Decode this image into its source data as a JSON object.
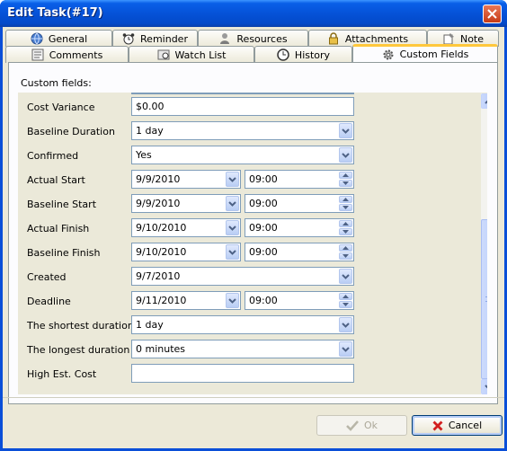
{
  "window": {
    "title": "Edit Task(#17)"
  },
  "tabs_row1": [
    {
      "label": "General",
      "icon": "globe-icon"
    },
    {
      "label": "Reminder",
      "icon": "alarm-clock-icon"
    },
    {
      "label": "Resources",
      "icon": "person-icon"
    },
    {
      "label": "Attachments",
      "icon": "lock-icon"
    },
    {
      "label": "Note",
      "icon": "note-pin-icon"
    }
  ],
  "tabs_row2": [
    {
      "label": "Comments",
      "icon": "comments-icon"
    },
    {
      "label": "Watch List",
      "icon": "watch-list-icon"
    },
    {
      "label": "History",
      "icon": "history-clock-icon"
    },
    {
      "label": "Custom Fields",
      "icon": "gear-icon",
      "active": true
    }
  ],
  "panel": {
    "label": "Custom fields:"
  },
  "fields": [
    {
      "label": "Cost Variance",
      "value": "$0.00",
      "type": "text"
    },
    {
      "label": "Baseline Duration",
      "value": "1 day",
      "type": "combo"
    },
    {
      "label": "Confirmed",
      "value": "Yes",
      "type": "combo"
    },
    {
      "label": "Actual Start",
      "value": "9/9/2010",
      "time": "09:00",
      "type": "datetime"
    },
    {
      "label": "Baseline Start",
      "value": "9/9/2010",
      "time": "09:00",
      "type": "datetime"
    },
    {
      "label": "Actual Finish",
      "value": "9/10/2010",
      "time": "09:00",
      "type": "datetime"
    },
    {
      "label": "Baseline Finish",
      "value": "9/10/2010",
      "time": "09:00",
      "type": "datetime"
    },
    {
      "label": "Created",
      "value": "9/7/2010",
      "type": "combo"
    },
    {
      "label": "Deadline",
      "value": "9/11/2010",
      "time": "09:00",
      "type": "datetime"
    },
    {
      "label": "The shortest duration",
      "value": "1 day",
      "type": "combo"
    },
    {
      "label": "The longest duration",
      "value": "0 minutes",
      "type": "combo"
    },
    {
      "label": "High Est. Cost",
      "value": "",
      "type": "text"
    }
  ],
  "buttons": {
    "ok": "Ok",
    "cancel": "Cancel"
  },
  "colors": {
    "accent": "#0a4fd8",
    "active_tab": "#ffc83c",
    "cancel_icon": "#d21f1f"
  }
}
